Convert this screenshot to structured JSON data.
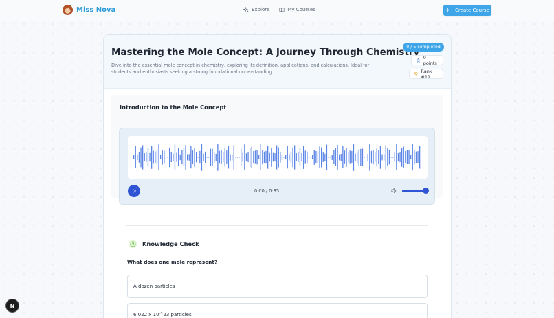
{
  "brand": {
    "name": "Miss Nova",
    "avatar_icon": "avatar-icon"
  },
  "nav": {
    "explore": "Explore",
    "explore_icon": "sparkles-icon",
    "my_courses": "My Courses",
    "my_courses_icon": "book-open-icon"
  },
  "header": {
    "create_course": "Create Course",
    "create_icon": "sparkles-icon"
  },
  "course": {
    "title": "Mastering the Mole Concept: A Journey Through Chemistry",
    "description": "Dive into the essential mole concept in chemistry, exploring its definition, applications, and calculations. Ideal for students and enthusiasts seeking a strong foundational understanding.",
    "completed": "0 / 5 completed",
    "points": "0 points",
    "rank": "Rank #11"
  },
  "lesson": {
    "title": "Introduction to the Mole Concept",
    "audio": {
      "time": "0:00 / 0:35",
      "volume_fraction": 1.0,
      "play_icon": "play-icon",
      "volume_icon": "volume-icon"
    }
  },
  "quiz": {
    "heading": "Knowledge Check",
    "question": "What does one mole represent?",
    "options": [
      "A dozen particles",
      "6.022 x 10^23 particles"
    ]
  },
  "corner": {
    "label": "N"
  },
  "colors": {
    "accent": "#3da5e8",
    "player_blue": "#2f55d4",
    "wave": "#5b86e5",
    "brand_text": "#2c9bd9"
  }
}
